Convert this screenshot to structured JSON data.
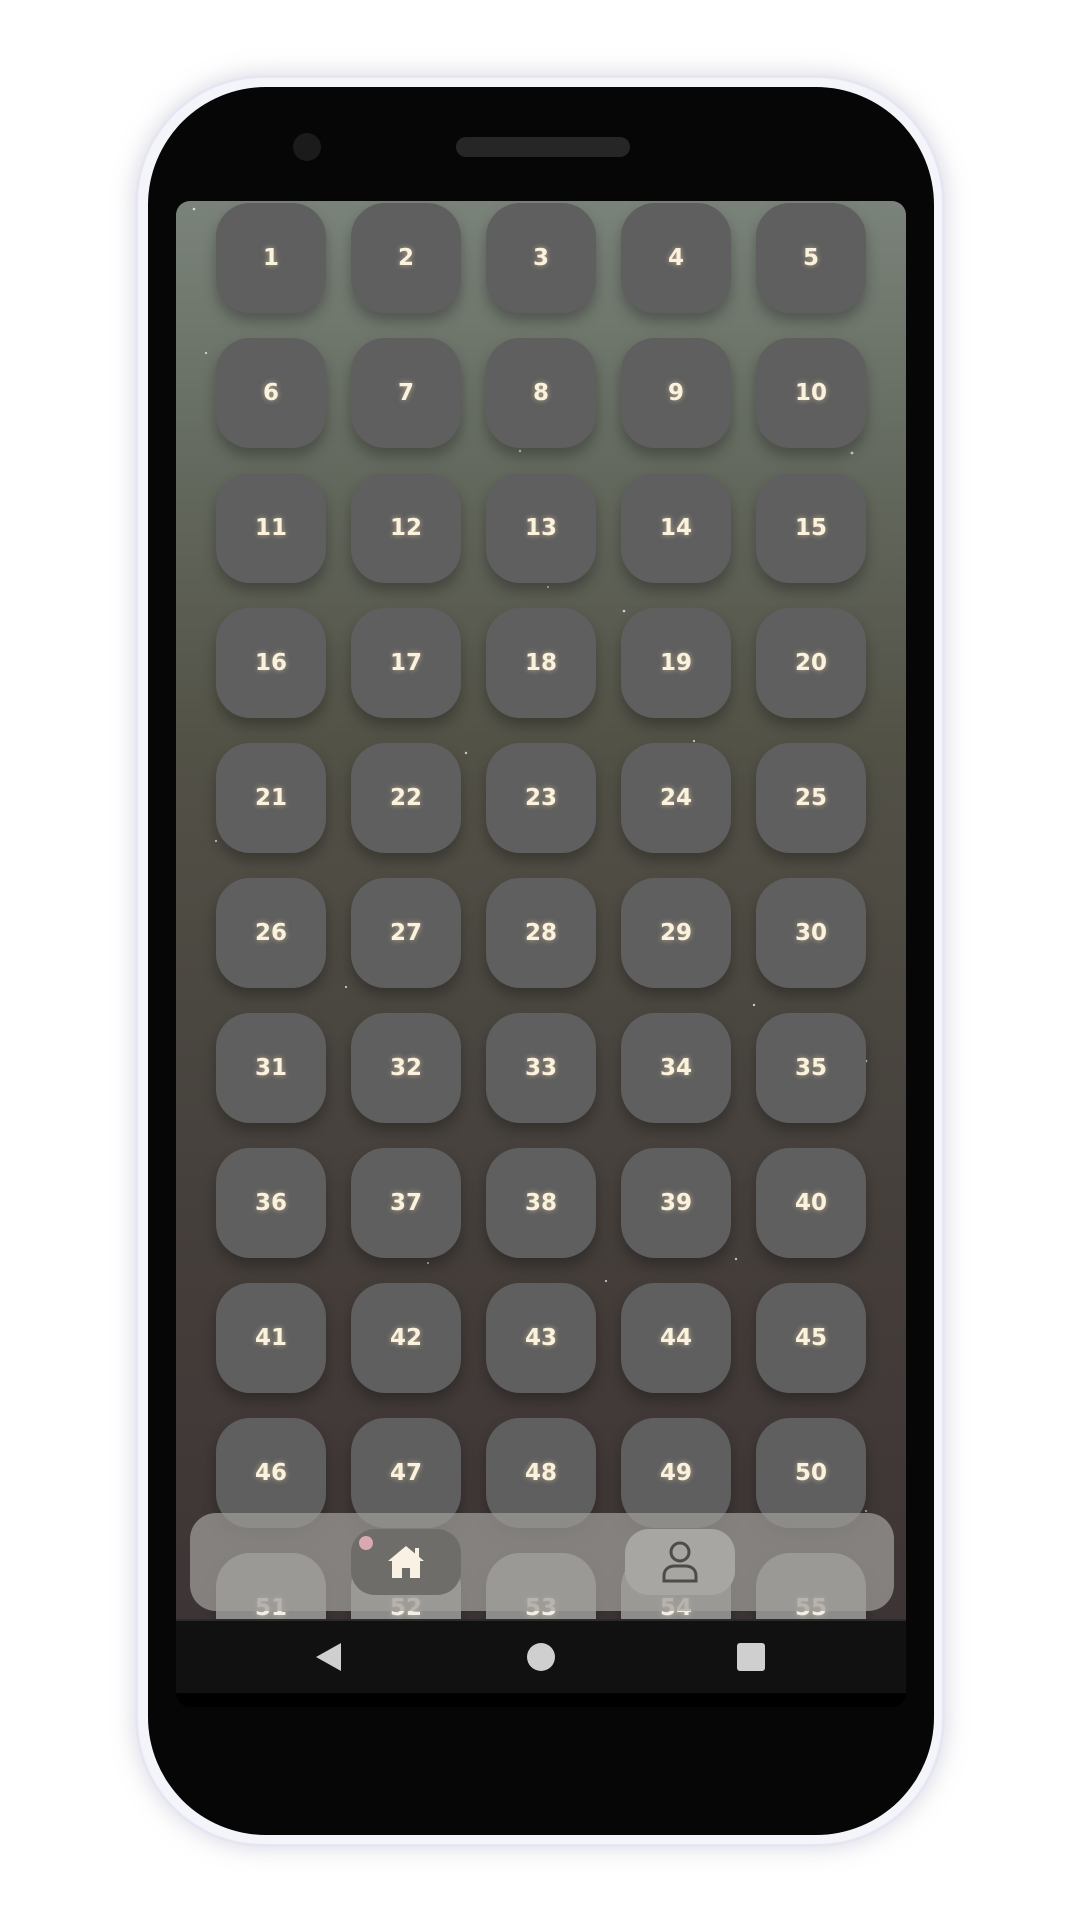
{
  "tiles": [
    "1",
    "2",
    "3",
    "4",
    "5",
    "6",
    "7",
    "8",
    "9",
    "10",
    "11",
    "12",
    "13",
    "14",
    "15",
    "16",
    "17",
    "18",
    "19",
    "20",
    "21",
    "22",
    "23",
    "24",
    "25",
    "26",
    "27",
    "28",
    "29",
    "30",
    "31",
    "32",
    "33",
    "34",
    "35",
    "36",
    "37",
    "38",
    "39",
    "40",
    "41",
    "42",
    "43",
    "44",
    "45",
    "46",
    "47",
    "48",
    "49",
    "50",
    "51",
    "52",
    "53",
    "54",
    "55"
  ],
  "bottom_nav": {
    "items": [
      {
        "name": "home",
        "icon": "home-icon",
        "active": true,
        "notification_dot": true
      },
      {
        "name": "profile",
        "icon": "user-icon",
        "active": false
      }
    ]
  },
  "system_nav": {
    "back_icon": "back-triangle-icon",
    "home_icon": "home-circle-icon",
    "recents_icon": "recents-square-icon"
  },
  "colors": {
    "tile_bg": "#5f5f5f",
    "tile_text": "#fbf2de",
    "notification_dot": "#d9a8b0",
    "gradient_top": "#7a837a",
    "gradient_bottom": "#3d3535"
  }
}
